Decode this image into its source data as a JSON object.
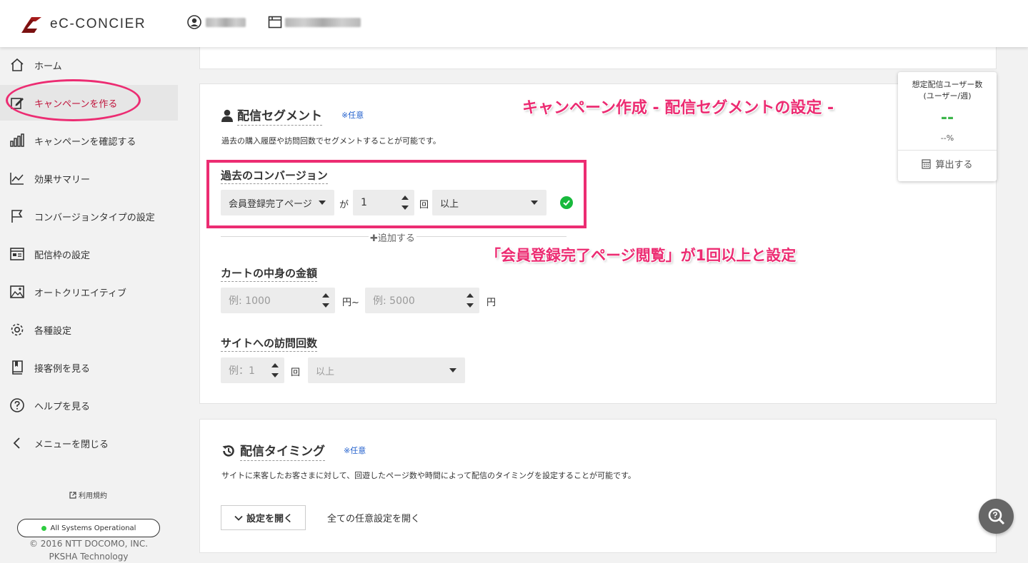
{
  "header": {
    "logo_text": "eC-CONCIER"
  },
  "sidebar": {
    "items": [
      {
        "label": "ホーム",
        "icon": "home-icon"
      },
      {
        "label": "キャンペーンを作る",
        "icon": "edit-icon",
        "active": true
      },
      {
        "label": "キャンペーンを確認する",
        "icon": "bar-chart-icon"
      },
      {
        "label": "効果サマリー",
        "icon": "line-chart-icon"
      },
      {
        "label": "コンバージョンタイプの設定",
        "icon": "flag-icon"
      },
      {
        "label": "配信枠の設定",
        "icon": "window-icon"
      },
      {
        "label": "オートクリエイティブ",
        "icon": "image-icon"
      },
      {
        "label": "各種設定",
        "icon": "gear-icon"
      },
      {
        "label": "接客例を見る",
        "icon": "book-icon"
      },
      {
        "label": "ヘルプを見る",
        "icon": "question-icon"
      },
      {
        "label": "メニューを閉じる",
        "icon": "chevron-left-icon"
      }
    ],
    "terms_label": "利用規約",
    "status_label": "All Systems Operational",
    "copyright_line1": "© 2016 NTT DOCOMO, INC.",
    "copyright_line2": "PKSHA Technology"
  },
  "segment": {
    "title": "配信セグメント",
    "optional": "※任意",
    "description": "過去の購入履歴や訪問回数でセグメントすることが可能です。",
    "past_conversion": {
      "title": "過去のコンバージョン",
      "page_select": "会員登録完了ページ",
      "particle": "が",
      "count": "1",
      "unit": "回",
      "condition": "以上"
    },
    "add_label": "✚追加する",
    "cart": {
      "title": "カートの中身の金額",
      "min_placeholder": "例: 1000",
      "range_sep": "円~",
      "max_placeholder": "例: 5000",
      "unit": "円"
    },
    "visits": {
      "title": "サイトへの訪問回数",
      "count_placeholder": "例：1",
      "unit": "回",
      "condition": "以上"
    }
  },
  "timing": {
    "title": "配信タイミング",
    "optional": "※任意",
    "description": "サイトに来客したお客さまに対して、回遊したページ数や時間によって配信のタイミングを設定することが可能です。",
    "open_button": "設定を開く",
    "open_all": "全ての任意設定を開く"
  },
  "estimate": {
    "title_line1": "想定配信ユーザー数",
    "title_line2": "(ユーザー/週)",
    "value": "--",
    "percent": "--%",
    "calc_button": "算出する"
  },
  "annotations": {
    "heading": "キャンペーン作成 - 配信セグメントの設定 -",
    "note": "「会員登録完了ページ閲覧」が1回以上と設定"
  },
  "colors": {
    "accent_red": "#c0143c",
    "annotation_pink": "#ec2c72",
    "ok_green": "#18b93c",
    "link_blue": "#1f5ecc"
  }
}
